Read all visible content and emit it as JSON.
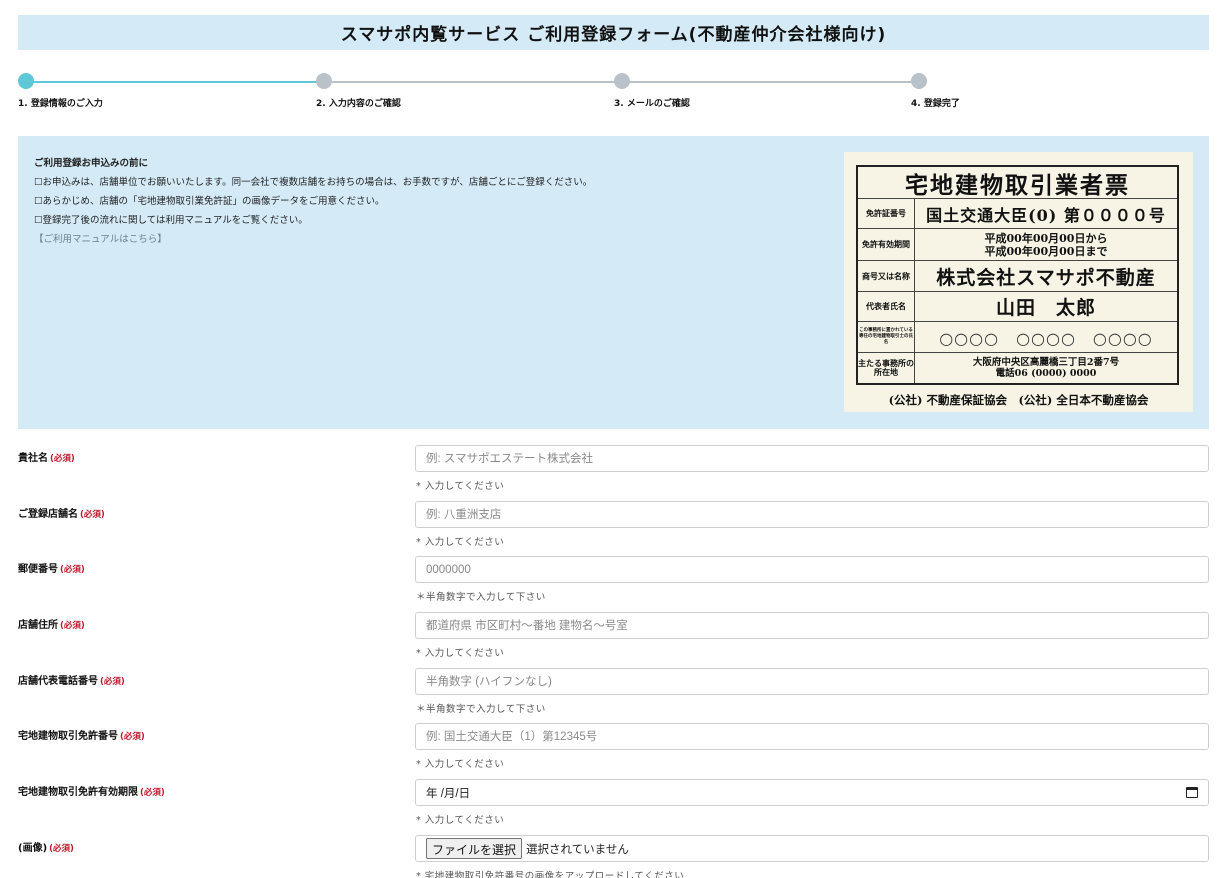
{
  "title": "スマサポ内覧サービス ご利用登録フォーム(不動産仲介会社様向け)",
  "steps": [
    {
      "label": "1. 登録情報のご入力",
      "active": true
    },
    {
      "label": "2. 入力内容のご確認",
      "active": false
    },
    {
      "label": "3. メールのご確認",
      "active": false
    },
    {
      "label": "4. 登録完了",
      "active": false
    }
  ],
  "info": {
    "heading": "ご利用登録お申込みの前に",
    "items": [
      "☐お申込みは、店舗単位でお願いいたします。同一会社で複数店舗をお持ちの場合は、お手数ですが、店舗ごとにご登録ください。",
      "☐あらかじめ、店舗の「宅地建物取引業免許証」の画像データをご用意ください。",
      "☐登録完了後の流れに関しては利用マニュアルをご覧ください。"
    ],
    "manual_link": "【ご利用マニュアルはこちら】"
  },
  "license_sample": {
    "title": "宅地建物取引業者票",
    "rows": [
      {
        "key": "免許証番号",
        "value": "国土交通大臣(0) 第００００号"
      },
      {
        "key": "免許有効期間",
        "value": "平成00年00月00日から\n平成00年00月00日まで"
      },
      {
        "key": "商号又は名称",
        "value": "株式会社スマサポ不動産"
      },
      {
        "key": "代表者氏名",
        "value": "山田　太郎"
      },
      {
        "key": "この事務所に置かれている専任の宅地建物取引士の氏名",
        "value": "○○○○　○○○○　○○○○"
      },
      {
        "key": "主たる事務所の所在地",
        "value": "大阪府中央区高麗橋三丁目2番7号\n電話06 (0000) 0000"
      }
    ],
    "footer": "(公社) 不動産保証協会　(公社) 全日本不動産協会"
  },
  "form": {
    "required_label": "(必須)",
    "fields": [
      {
        "label": "貴社名",
        "placeholder": "例: スマサポエステート株式会社",
        "help": "* 入力してください"
      },
      {
        "label": "ご登録店舗名",
        "placeholder": "例: 八重洲支店",
        "help": "* 入力してください"
      },
      {
        "label": "郵便番号",
        "placeholder": "0000000",
        "help": "＊半角数字で入力して下さい"
      },
      {
        "label": "店舗住所",
        "placeholder": "都道府県 市区町村〜番地 建物名〜号室",
        "help": "* 入力してください"
      },
      {
        "label": "店舗代表電話番号",
        "placeholder": "半角数字 (ハイフンなし)",
        "help": "＊半角数字で入力して下さい"
      },
      {
        "label": "宅地建物取引免許番号",
        "placeholder": "例: 国土交通大臣（1）第12345号",
        "help": "* 入力してください"
      },
      {
        "label": "宅地建物取引免許有効期限",
        "date_text": "年 /月/日",
        "help": "* 入力してください"
      },
      {
        "label": "(画像)",
        "file_button": "ファイルを選択",
        "file_status": "選択されていません",
        "help": "* 宅地建物取引免許番号の画像をアップロードしてください"
      }
    ]
  },
  "colors": {
    "accent": "#5fc8d8",
    "panel": "#d4ebf7",
    "required": "#c0182b"
  }
}
